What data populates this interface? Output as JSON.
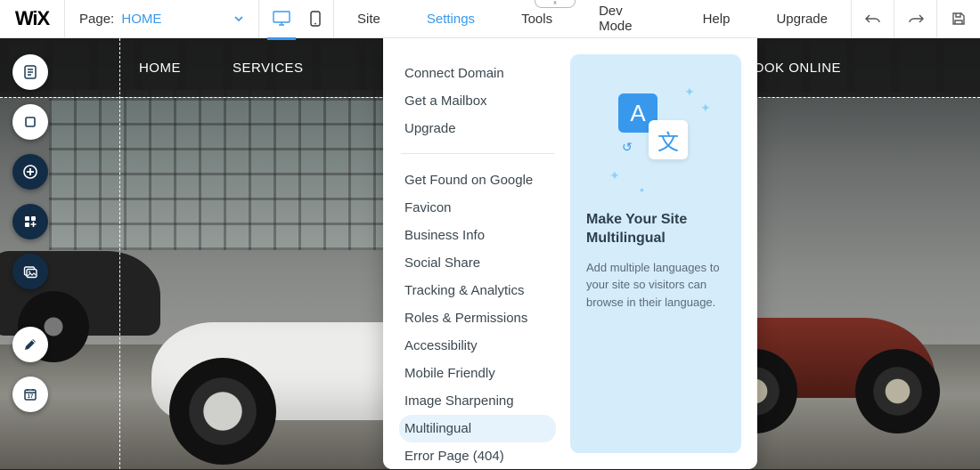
{
  "logo": "WiX",
  "page_label": "Page:",
  "page_name": "HOME",
  "toppill": "x",
  "top_menu": {
    "site": "Site",
    "settings": "Settings",
    "tools": "Tools",
    "devmode": "Dev Mode",
    "help": "Help",
    "upgrade": "Upgrade"
  },
  "site_nav": {
    "home": "HOME",
    "services": "SERVICES",
    "book": "BOOK ONLINE"
  },
  "settings_menu": {
    "group1": {
      "connect_domain": "Connect Domain",
      "get_mailbox": "Get a Mailbox",
      "upgrade": "Upgrade"
    },
    "group2": {
      "get_found": "Get Found on Google",
      "favicon": "Favicon",
      "business_info": "Business Info",
      "social_share": "Social Share",
      "tracking": "Tracking & Analytics",
      "roles": "Roles & Permissions",
      "accessibility": "Accessibility",
      "mobile": "Mobile Friendly",
      "sharpening": "Image Sharpening",
      "multilingual": "Multilingual",
      "error_page": "Error Page (404)"
    }
  },
  "promo": {
    "tileA_glyph": "A",
    "tileB_glyph": "文",
    "title": "Make Your Site Multilingual",
    "body": "Add multiple languages to your site so visitors can browse in their language."
  }
}
